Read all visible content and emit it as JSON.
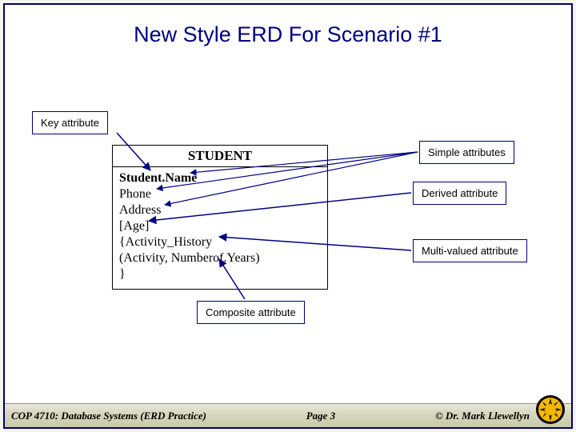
{
  "title": "New Style ERD For Scenario #1",
  "callouts": {
    "key": "Key attribute",
    "simple": "Simple attributes",
    "derived": "Derived attribute",
    "multi": "Multi-valued attribute",
    "composite": "Composite attribute"
  },
  "erd": {
    "entity": "STUDENT",
    "lines": [
      "Student.Name",
      "Phone",
      "Address",
      "[Age]",
      "{Activity_History",
      "(Activity, Numberof.Years)",
      "}"
    ]
  },
  "footer": {
    "left": "COP 4710: Database Systems  (ERD Practice)",
    "center": "Page 3",
    "right": "© Dr. Mark Llewellyn"
  }
}
